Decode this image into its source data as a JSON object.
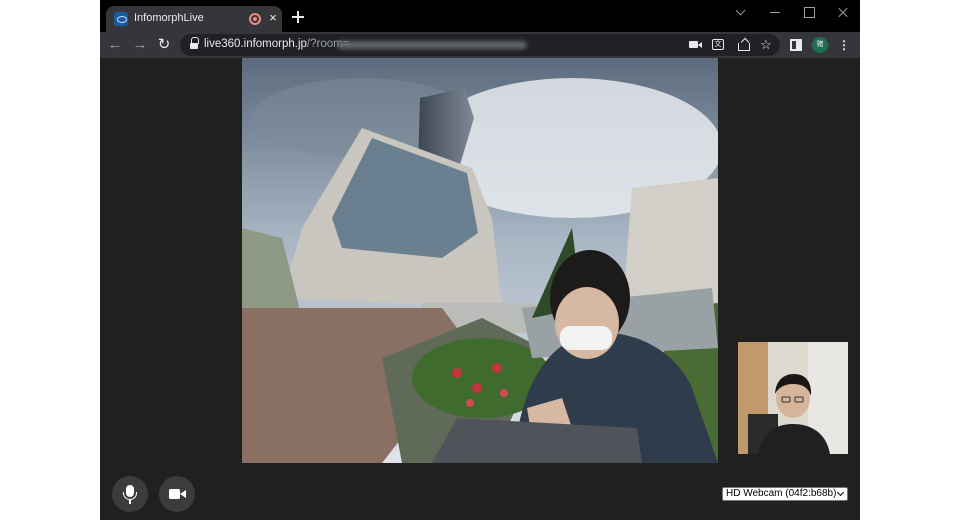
{
  "browser": {
    "tab": {
      "title": "InfomorphLive",
      "close_glyph": "×"
    },
    "new_tab_icon": "plus-icon",
    "window_controls": [
      "chevron-down-icon",
      "minimize-icon",
      "maximize-icon",
      "close-icon"
    ]
  },
  "toolbar": {
    "back_glyph": "←",
    "forward_glyph": "→",
    "reload_glyph": "↻",
    "url_host": "live360.infomorph.jp",
    "url_path": "/?room=",
    "star_glyph": "☆",
    "translate_glyph": "文",
    "profile_initial": "猪",
    "menu_glyph": "⋮"
  },
  "controls": {
    "mic_icon": "microphone-icon",
    "camera_icon": "video-camera-icon"
  },
  "device_select": {
    "selected": "HD Webcam (04f2:b68b)"
  },
  "colors": {
    "tabstrip": "#000000",
    "toolbar": "#35363a",
    "viewport": "#202020",
    "control_button": "#3c3c3c",
    "record_indicator": "#f28b82"
  }
}
